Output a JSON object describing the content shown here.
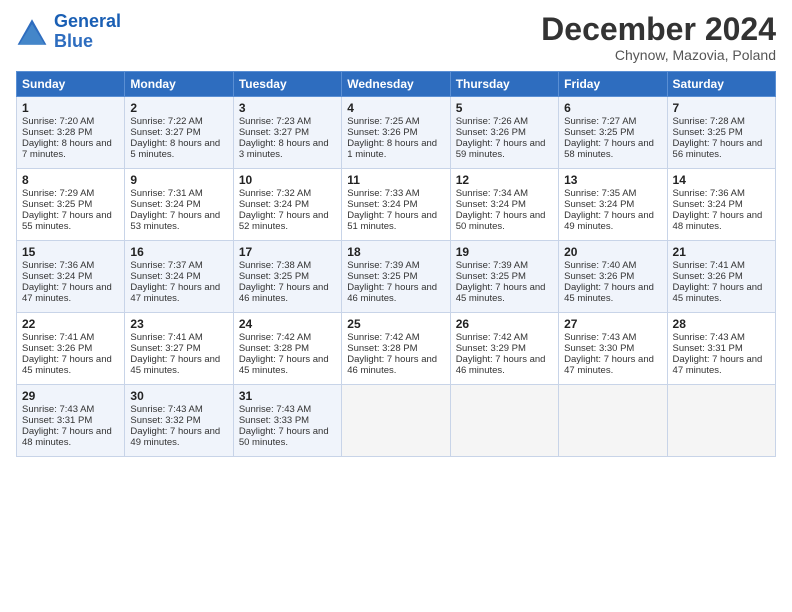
{
  "logo": {
    "line1": "General",
    "line2": "Blue"
  },
  "title": "December 2024",
  "subtitle": "Chynow, Mazovia, Poland",
  "days": [
    "Sunday",
    "Monday",
    "Tuesday",
    "Wednesday",
    "Thursday",
    "Friday",
    "Saturday"
  ],
  "weeks": [
    [
      {
        "day": 1,
        "sunrise": "7:20 AM",
        "sunset": "3:28 PM",
        "daylight": "8 hours and 7 minutes."
      },
      {
        "day": 2,
        "sunrise": "7:22 AM",
        "sunset": "3:27 PM",
        "daylight": "8 hours and 5 minutes."
      },
      {
        "day": 3,
        "sunrise": "7:23 AM",
        "sunset": "3:27 PM",
        "daylight": "8 hours and 3 minutes."
      },
      {
        "day": 4,
        "sunrise": "7:25 AM",
        "sunset": "3:26 PM",
        "daylight": "8 hours and 1 minute."
      },
      {
        "day": 5,
        "sunrise": "7:26 AM",
        "sunset": "3:26 PM",
        "daylight": "7 hours and 59 minutes."
      },
      {
        "day": 6,
        "sunrise": "7:27 AM",
        "sunset": "3:25 PM",
        "daylight": "7 hours and 58 minutes."
      },
      {
        "day": 7,
        "sunrise": "7:28 AM",
        "sunset": "3:25 PM",
        "daylight": "7 hours and 56 minutes."
      }
    ],
    [
      {
        "day": 8,
        "sunrise": "7:29 AM",
        "sunset": "3:25 PM",
        "daylight": "7 hours and 55 minutes."
      },
      {
        "day": 9,
        "sunrise": "7:31 AM",
        "sunset": "3:24 PM",
        "daylight": "7 hours and 53 minutes."
      },
      {
        "day": 10,
        "sunrise": "7:32 AM",
        "sunset": "3:24 PM",
        "daylight": "7 hours and 52 minutes."
      },
      {
        "day": 11,
        "sunrise": "7:33 AM",
        "sunset": "3:24 PM",
        "daylight": "7 hours and 51 minutes."
      },
      {
        "day": 12,
        "sunrise": "7:34 AM",
        "sunset": "3:24 PM",
        "daylight": "7 hours and 50 minutes."
      },
      {
        "day": 13,
        "sunrise": "7:35 AM",
        "sunset": "3:24 PM",
        "daylight": "7 hours and 49 minutes."
      },
      {
        "day": 14,
        "sunrise": "7:36 AM",
        "sunset": "3:24 PM",
        "daylight": "7 hours and 48 minutes."
      }
    ],
    [
      {
        "day": 15,
        "sunrise": "7:36 AM",
        "sunset": "3:24 PM",
        "daylight": "7 hours and 47 minutes."
      },
      {
        "day": 16,
        "sunrise": "7:37 AM",
        "sunset": "3:24 PM",
        "daylight": "7 hours and 47 minutes."
      },
      {
        "day": 17,
        "sunrise": "7:38 AM",
        "sunset": "3:25 PM",
        "daylight": "7 hours and 46 minutes."
      },
      {
        "day": 18,
        "sunrise": "7:39 AM",
        "sunset": "3:25 PM",
        "daylight": "7 hours and 46 minutes."
      },
      {
        "day": 19,
        "sunrise": "7:39 AM",
        "sunset": "3:25 PM",
        "daylight": "7 hours and 45 minutes."
      },
      {
        "day": 20,
        "sunrise": "7:40 AM",
        "sunset": "3:26 PM",
        "daylight": "7 hours and 45 minutes."
      },
      {
        "day": 21,
        "sunrise": "7:41 AM",
        "sunset": "3:26 PM",
        "daylight": "7 hours and 45 minutes."
      }
    ],
    [
      {
        "day": 22,
        "sunrise": "7:41 AM",
        "sunset": "3:26 PM",
        "daylight": "7 hours and 45 minutes."
      },
      {
        "day": 23,
        "sunrise": "7:41 AM",
        "sunset": "3:27 PM",
        "daylight": "7 hours and 45 minutes."
      },
      {
        "day": 24,
        "sunrise": "7:42 AM",
        "sunset": "3:28 PM",
        "daylight": "7 hours and 45 minutes."
      },
      {
        "day": 25,
        "sunrise": "7:42 AM",
        "sunset": "3:28 PM",
        "daylight": "7 hours and 46 minutes."
      },
      {
        "day": 26,
        "sunrise": "7:42 AM",
        "sunset": "3:29 PM",
        "daylight": "7 hours and 46 minutes."
      },
      {
        "day": 27,
        "sunrise": "7:43 AM",
        "sunset": "3:30 PM",
        "daylight": "7 hours and 47 minutes."
      },
      {
        "day": 28,
        "sunrise": "7:43 AM",
        "sunset": "3:31 PM",
        "daylight": "7 hours and 47 minutes."
      }
    ],
    [
      {
        "day": 29,
        "sunrise": "7:43 AM",
        "sunset": "3:31 PM",
        "daylight": "7 hours and 48 minutes."
      },
      {
        "day": 30,
        "sunrise": "7:43 AM",
        "sunset": "3:32 PM",
        "daylight": "7 hours and 49 minutes."
      },
      {
        "day": 31,
        "sunrise": "7:43 AM",
        "sunset": "3:33 PM",
        "daylight": "7 hours and 50 minutes."
      },
      null,
      null,
      null,
      null
    ]
  ],
  "labels": {
    "sunrise": "Sunrise:",
    "sunset": "Sunset:",
    "daylight": "Daylight:"
  }
}
